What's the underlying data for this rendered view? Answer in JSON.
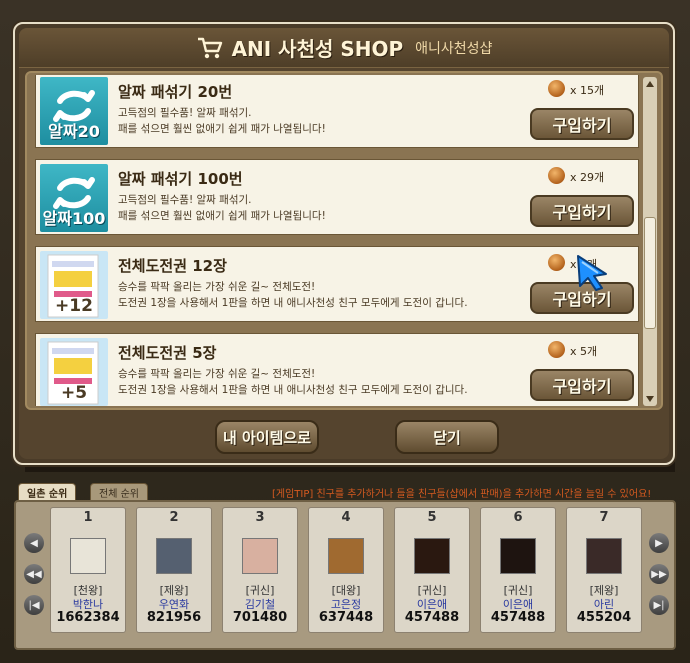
{
  "shop": {
    "title": "ANI 사천성 SHOP",
    "subtitle": "애니사천성샵",
    "items": [
      {
        "name": "알짜 패섞기 20번",
        "desc1": "고득점의 필수품! 알짜 패섞기.",
        "desc2": "패를 섞으면 훨씬 없애기 쉽게 패가 나열됩니다!",
        "price": "x 15개",
        "buy": "구입하기",
        "thumb_label": "알짜20",
        "thumb": "shuffle"
      },
      {
        "name": "알짜 패섞기 100번",
        "desc1": "고득점의 필수품! 알짜 패섞기.",
        "desc2": "패를 섞으면 훨씬 없애기 쉽게 패가 나열됩니다!",
        "price": "x 29개",
        "buy": "구입하기",
        "thumb_label": "알짜100",
        "thumb": "shuffle"
      },
      {
        "name": "전체도전권 12장",
        "desc1": "승수를 팍팍 올리는 가장 쉬운 길~ 전체도전!",
        "desc2": "도전권 1장을 사용해서 1판을 하면 내 애니사천성 친구 모두에게 도전이 갑니다.",
        "price": "x 9개",
        "buy": "구입하기",
        "thumb_label": "+12",
        "thumb": "ticket"
      },
      {
        "name": "전체도전권 5장",
        "desc1": "승수를 팍팍 올리는 가장 쉬운 길~ 전체도전!",
        "desc2": "도전권 1장을 사용해서 1판을 하면 내 애니사천성 친구 모두에게 도전이 갑니다.",
        "price": "x 5개",
        "buy": "구입하기",
        "thumb_label": "+5",
        "thumb": "ticket"
      }
    ],
    "my_items_button": "내 아이템으로",
    "close_button": "닫기"
  },
  "background": {
    "tabs": [
      "일촌 순위",
      "전체 순위"
    ],
    "tip": "[게임TIP] 친구를 추가하거나 들을 친구들(샵에서 판매)을 추가하면 시간을 늘일 수 있어요!",
    "rankings": [
      {
        "rank": "1",
        "title": "[천왕]",
        "name": "박한나",
        "score": "1662384"
      },
      {
        "rank": "2",
        "title": "[제왕]",
        "name": "우연화",
        "score": "821956"
      },
      {
        "rank": "3",
        "title": "[귀신]",
        "name": "김기철",
        "score": "701480"
      },
      {
        "rank": "4",
        "title": "[대왕]",
        "name": "고은정",
        "score": "637448"
      },
      {
        "rank": "5",
        "title": "[귀신]",
        "name": "이은애",
        "score": "457488"
      },
      {
        "rank": "6",
        "title": "[귀신]",
        "name": "이은애",
        "score": "457488"
      },
      {
        "rank": "7",
        "title": "[제왕]",
        "name": "아린",
        "score": "455204"
      }
    ]
  },
  "colors": {
    "coin": "#c0702a",
    "name_blue": "#2a3aa0",
    "tip_orange": "#d45a20",
    "cursor_blue": "#1e90ff"
  },
  "icons": {
    "cart": "cart-icon",
    "coin": "coin-icon",
    "cursor": "pointer-cursor-icon",
    "shuffle": "shuffle-arrows-icon"
  }
}
